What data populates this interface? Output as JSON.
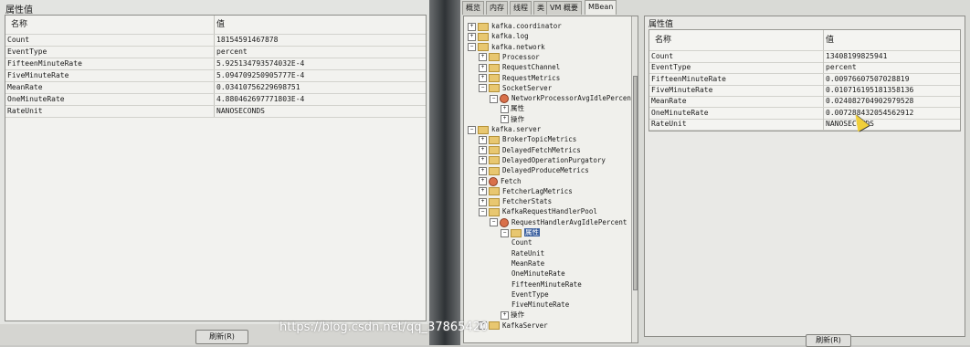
{
  "left": {
    "title": "属性值",
    "header": {
      "name": "名称",
      "value": "值"
    },
    "rows": [
      {
        "name": "Count",
        "value": "18154591467878"
      },
      {
        "name": "EventType",
        "value": "percent"
      },
      {
        "name": "FifteenMinuteRate",
        "value": "5.925134793574032E-4"
      },
      {
        "name": "FiveMinuteRate",
        "value": "5.094709250905777E-4"
      },
      {
        "name": "MeanRate",
        "value": "0.03410756229698751"
      },
      {
        "name": "OneMinuteRate",
        "value": "4.880462697771803E-4"
      },
      {
        "name": "RateUnit",
        "value": "NANOSECONDS"
      }
    ],
    "refresh_label": "刷新(R)"
  },
  "tabs": [
    "概览",
    "内存",
    "线程",
    "类",
    "VM 概要",
    "MBean"
  ],
  "active_tab": "MBean",
  "tree": [
    {
      "text": "kafka.coordinator",
      "level": 0,
      "kind": "folder",
      "exp": "+"
    },
    {
      "text": "kafka.log",
      "level": 0,
      "kind": "folder",
      "exp": "+"
    },
    {
      "text": "kafka.network",
      "level": 0,
      "kind": "folder",
      "exp": "-"
    },
    {
      "text": "Processor",
      "level": 1,
      "kind": "folder",
      "exp": "+"
    },
    {
      "text": "RequestChannel",
      "level": 1,
      "kind": "folder",
      "exp": "+"
    },
    {
      "text": "RequestMetrics",
      "level": 1,
      "kind": "folder",
      "exp": "+"
    },
    {
      "text": "SocketServer",
      "level": 1,
      "kind": "folder",
      "exp": "-"
    },
    {
      "text": "NetworkProcessorAvgIdlePercent",
      "level": 2,
      "kind": "bean",
      "exp": "-"
    },
    {
      "text": "属性",
      "level": 3,
      "kind": "plain",
      "exp": "+"
    },
    {
      "text": "操作",
      "level": 3,
      "kind": "plain",
      "exp": "+"
    },
    {
      "text": "kafka.server",
      "level": 0,
      "kind": "folder",
      "exp": "-"
    },
    {
      "text": "BrokerTopicMetrics",
      "level": 1,
      "kind": "folder",
      "exp": "+"
    },
    {
      "text": "DelayedFetchMetrics",
      "level": 1,
      "kind": "folder",
      "exp": "+"
    },
    {
      "text": "DelayedOperationPurgatory",
      "level": 1,
      "kind": "folder",
      "exp": "+"
    },
    {
      "text": "DelayedProduceMetrics",
      "level": 1,
      "kind": "folder",
      "exp": "+"
    },
    {
      "text": "Fetch",
      "level": 1,
      "kind": "bean",
      "exp": "+"
    },
    {
      "text": "FetcherLagMetrics",
      "level": 1,
      "kind": "folder",
      "exp": "+"
    },
    {
      "text": "FetcherStats",
      "level": 1,
      "kind": "folder",
      "exp": "+"
    },
    {
      "text": "KafkaRequestHandlerPool",
      "level": 1,
      "kind": "folder",
      "exp": "-"
    },
    {
      "text": "RequestHandlerAvgIdlePercent",
      "level": 2,
      "kind": "bean",
      "exp": "-"
    },
    {
      "text": "属性",
      "level": 3,
      "kind": "folder",
      "exp": "-",
      "selected": true
    },
    {
      "text": "Count",
      "level": 4,
      "kind": "plain",
      "exp": ""
    },
    {
      "text": "RateUnit",
      "level": 4,
      "kind": "plain",
      "exp": ""
    },
    {
      "text": "MeanRate",
      "level": 4,
      "kind": "plain",
      "exp": ""
    },
    {
      "text": "OneMinuteRate",
      "level": 4,
      "kind": "plain",
      "exp": ""
    },
    {
      "text": "FifteenMinuteRate",
      "level": 4,
      "kind": "plain",
      "exp": ""
    },
    {
      "text": "EventType",
      "level": 4,
      "kind": "plain",
      "exp": ""
    },
    {
      "text": "FiveMinuteRate",
      "level": 4,
      "kind": "plain",
      "exp": ""
    },
    {
      "text": "操作",
      "level": 3,
      "kind": "plain",
      "exp": "+"
    },
    {
      "text": "KafkaServer",
      "level": 1,
      "kind": "folder",
      "exp": "+"
    }
  ],
  "right": {
    "title": "属性值",
    "header": {
      "name": "名称",
      "value": "值"
    },
    "rows": [
      {
        "name": "Count",
        "value": "13408199825941"
      },
      {
        "name": "EventType",
        "value": "percent"
      },
      {
        "name": "FifteenMinuteRate",
        "value": "0.00976607507028819"
      },
      {
        "name": "FiveMinuteRate",
        "value": "0.010716195181358136"
      },
      {
        "name": "MeanRate",
        "value": "0.024082704902979528"
      },
      {
        "name": "OneMinuteRate",
        "value": "0.007288432054562912"
      },
      {
        "name": "RateUnit",
        "value": "NANOSECONDS"
      }
    ],
    "refresh_label": "刷新(R)"
  },
  "watermark": "https://blog.csdn.net/qq_37865420"
}
